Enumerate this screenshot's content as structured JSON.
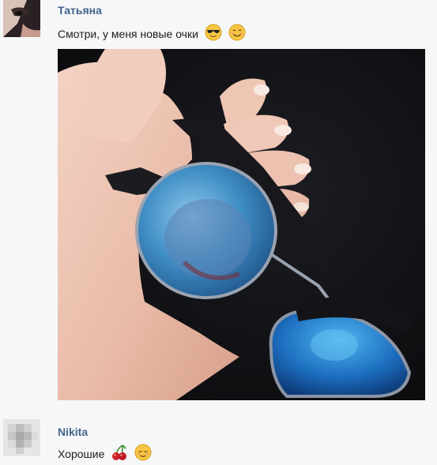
{
  "messages": [
    {
      "author": "Татьяна",
      "text": "Смотри, у меня новые очки",
      "emojis": [
        "sunglasses-emoji",
        "smiling-face-emoji"
      ]
    },
    {
      "author": "Nikita",
      "text": "Хорошие",
      "emojis": [
        "cherries-emoji",
        "relieved-face-emoji"
      ]
    }
  ],
  "colors": {
    "author": "#42648b",
    "background": "#f6f7f9",
    "text": "#1c1c1c"
  }
}
